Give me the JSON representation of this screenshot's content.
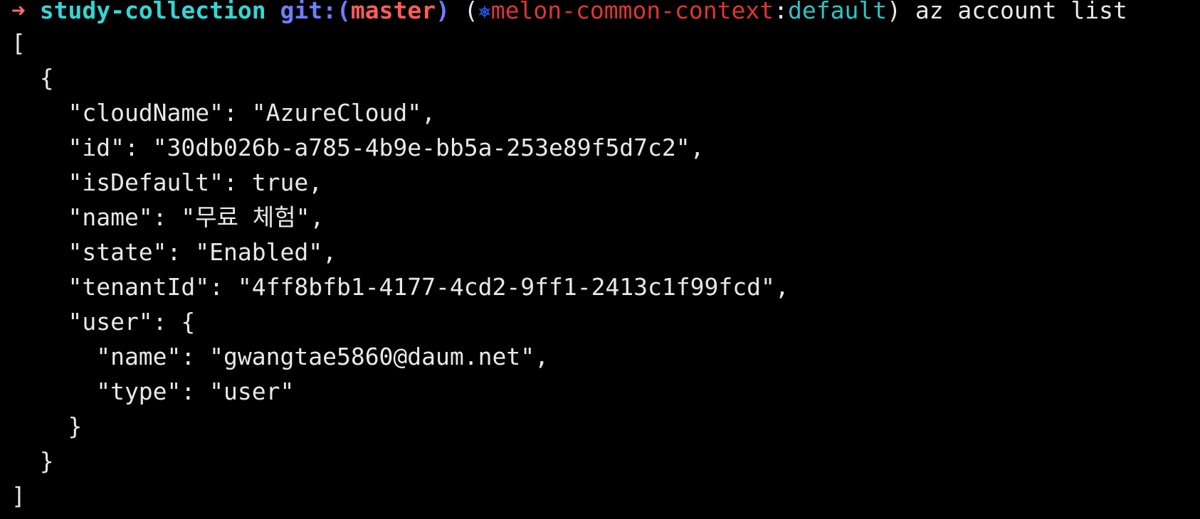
{
  "prompt": {
    "arrow": "➜",
    "directory": "study-collection",
    "git_label": "git:(",
    "branch": "master",
    "git_close": ")",
    "k8s_open": "(",
    "k8s_icon": "⎈",
    "k8s_context": "melon-common-context",
    "k8s_separator": ":",
    "k8s_namespace": "default",
    "k8s_close": ")",
    "command": "az account list"
  },
  "output": {
    "lines": [
      "[",
      "  {",
      "    \"cloudName\": \"AzureCloud\",",
      "    \"id\": \"30db026b-a785-4b9e-bb5a-253e89f5d7c2\",",
      "    \"isDefault\": true,",
      "    \"name\": \"무료 체험\",",
      "    \"state\": \"Enabled\",",
      "    \"tenantId\": \"4ff8bfb1-4177-4cd2-9ff1-2413c1f99fcd\",",
      "    \"user\": {",
      "      \"name\": \"gwangtae5860@daum.net\",",
      "      \"type\": \"user\"",
      "    }",
      "  }",
      "]"
    ]
  },
  "colors": {
    "background": "#000000",
    "foreground": "#e8e8e8",
    "arrow": "#ff6b6b",
    "directory": "#33d6d6",
    "git_label": "#6f7dff",
    "branch": "#ff5c5c",
    "k8s_icon": "#2f5bff",
    "k8s_context": "#e03535",
    "k8s_namespace": "#2ec4c4"
  }
}
